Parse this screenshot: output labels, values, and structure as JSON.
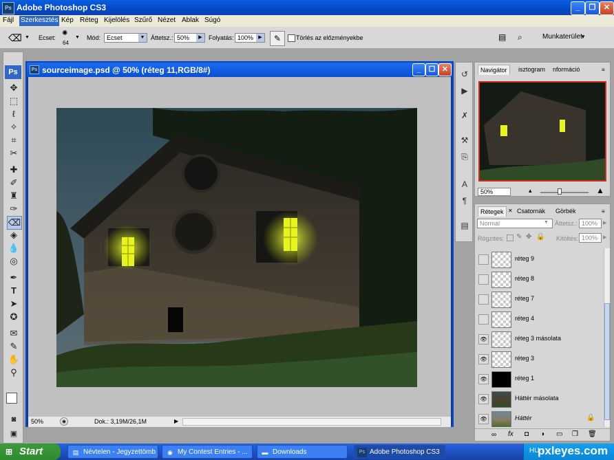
{
  "app": {
    "title": "Adobe Photoshop CS3",
    "ps_badge": "Ps"
  },
  "menu": [
    "Fájl",
    "Szerkesztés",
    "Kép",
    "Réteg",
    "Kijelölés",
    "Szűrő",
    "Nézet",
    "Ablak",
    "Súgó"
  ],
  "options": {
    "brush_label": "Ecset:",
    "brush_size": "64",
    "mode_label": "Mód:",
    "mode_value": "Ecset",
    "opacity_label": "Áttetsz.:",
    "opacity_value": "50%",
    "flow_label": "Folyatás:",
    "flow_value": "100%",
    "erase_history_label": "Törlés az előzményekbe",
    "workspace_label": "Munkaterület"
  },
  "document": {
    "title": "sourceimage.psd @ 50% (réteg 11,RGB/8#)",
    "zoom": "50%",
    "doc_info": "Dok.: 3,19M/26,1M"
  },
  "navigator": {
    "tabs": [
      "Navigátor",
      "isztogram",
      "nformáció"
    ],
    "zoom": "50%"
  },
  "layers_panel": {
    "tabs": [
      "Rétegek",
      "Csatornák",
      "Görbék"
    ],
    "blend_mode": "Normál",
    "opacity_label": "Áttetsz.:",
    "opacity_value": "100%",
    "lock_label": "Rögzítés:",
    "fill_label": "Kitöltés:",
    "fill_value": "100%",
    "layers": [
      {
        "name": "réteg 9",
        "visible": false,
        "thumb": "transparent"
      },
      {
        "name": "réteg 8",
        "visible": false,
        "thumb": "transparent"
      },
      {
        "name": "réteg 7",
        "visible": false,
        "thumb": "transparent"
      },
      {
        "name": "réteg 4",
        "visible": false,
        "thumb": "transparent"
      },
      {
        "name": "réteg 3 másolata",
        "visible": true,
        "thumb": "transparent"
      },
      {
        "name": "réteg 3",
        "visible": true,
        "thumb": "transparent"
      },
      {
        "name": "réteg 1",
        "visible": true,
        "thumb": "black"
      },
      {
        "name": "Háttér másolata",
        "visible": true,
        "thumb": "photo"
      },
      {
        "name": "Háttér",
        "visible": true,
        "thumb": "photo",
        "locked": true
      }
    ]
  },
  "taskbar": {
    "start": "Start",
    "tasks": [
      {
        "label": "Névtelen - Jegyzettömb"
      },
      {
        "label": "My Contest Entries - ..."
      },
      {
        "label": "Downloads"
      },
      {
        "label": "Adobe Photoshop CS3"
      }
    ],
    "tray_text": "HU",
    "watermark": "pxleyes.com"
  }
}
